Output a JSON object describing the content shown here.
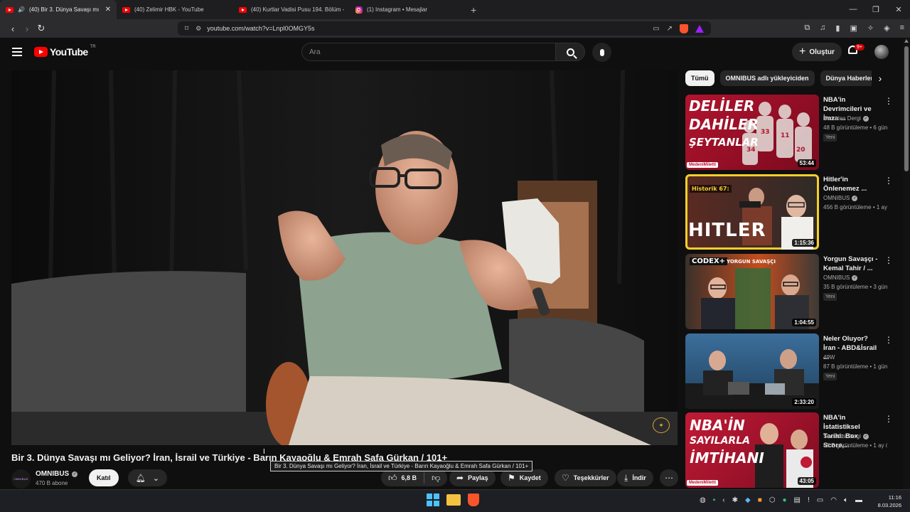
{
  "browser": {
    "tabs": [
      {
        "title": "(40) Bir 3. Dünya Savaşı mı Ge",
        "icon": "youtube-icon",
        "active": true
      },
      {
        "title": "(40) Zelimir HBK - YouTube",
        "icon": "youtube-icon"
      },
      {
        "title": "(40) Kurtlar Vadisi Pusu 194. Bölüm -",
        "icon": "youtube-icon"
      },
      {
        "title": "(1) Instagram • Mesajlar",
        "icon": "instagram-icon"
      }
    ],
    "url": "youtube.com/watch?v=Lnpl0OMGY5s"
  },
  "header": {
    "logo_text": "YouTube",
    "country_code": "TR",
    "search_placeholder": "Ara",
    "create_label": "Oluştur",
    "notification_count": "9+"
  },
  "video": {
    "title": "Bir 3. Dünya Savaşı mı Geliyor? İran, İsrail ve Türkiye - Barın Kayaoğlu & Emrah Safa Gürkan / 101+",
    "tooltip": "Bir 3. Dünya Savaşı mı Geliyor? İran, İsrail ve Türkiye - Barın Kayaoğlu & Emrah Safa Gürkan / 101+",
    "channel": "OMNIBUS",
    "channel_avatar_text": "OMNIBUS",
    "subscribers": "470 B abone",
    "join_label": "Katıl",
    "likes": "6,8 B",
    "share_label": "Paylaş",
    "save_label": "Kaydet",
    "thanks_label": "Teşekkürler",
    "download_label": "İndir"
  },
  "chips": [
    "Tümü",
    "OMNIBUS adlı yükleyiciden",
    "Dünya Haberleri"
  ],
  "recommendations": [
    {
      "title": "NBA'in Devrimcileri ve İmza ...",
      "channel": "Socrates Dergi",
      "meta": "48 B görüntüleme • 6 gün önce",
      "badge": "Yeni",
      "duration": "53:44",
      "thumb_lines": [
        "DELİLER",
        "DAHİLER",
        "ŞEYTANLAR"
      ],
      "thumb_tag": "MedeniMiletti"
    },
    {
      "title": "Hitler'in Önlenemez ...",
      "channel": "OMNIBUS",
      "meta": "456 B görüntüleme • 1 ay önce",
      "badge": "",
      "duration": "1:15:36",
      "thumb_lines": [
        "Historik 67:",
        "HITLER"
      ]
    },
    {
      "title": "Yorgun Savaşçı - Kemal Tahir / ...",
      "channel": "OMNIBUS",
      "meta": "35 B görüntüleme • 3 gün önce",
      "badge": "Yeni",
      "duration": "1:04:55",
      "thumb_lines": [
        "CODEX+",
        "YORGUN SAVAŞÇI"
      ]
    },
    {
      "title": "Neler Oluyor? İran - ABD&İsrail ...",
      "channel": "49W",
      "meta": "87 B görüntüleme • 1 gün önce",
      "badge": "Yeni",
      "duration": "2:33:20",
      "thumb_lines": []
    },
    {
      "title": "NBA'in İstatistiksel Tarihi: Box Score,...",
      "channel": "Socrates Dergi",
      "meta": "55 B görüntüleme • 1 ay önce",
      "badge": "",
      "duration": "43:05",
      "thumb_lines": [
        "NBA'İN",
        "SAYILARLA",
        "İMTİHANI"
      ],
      "thumb_tag": "MedeniMiletti"
    }
  ],
  "taskbar": {
    "time": "11:16",
    "date": "8.03.2026"
  },
  "colors": {
    "youtube_red": "#ff0000",
    "selected_outline": "#f6cf2a",
    "background": "#0f0f0f"
  }
}
